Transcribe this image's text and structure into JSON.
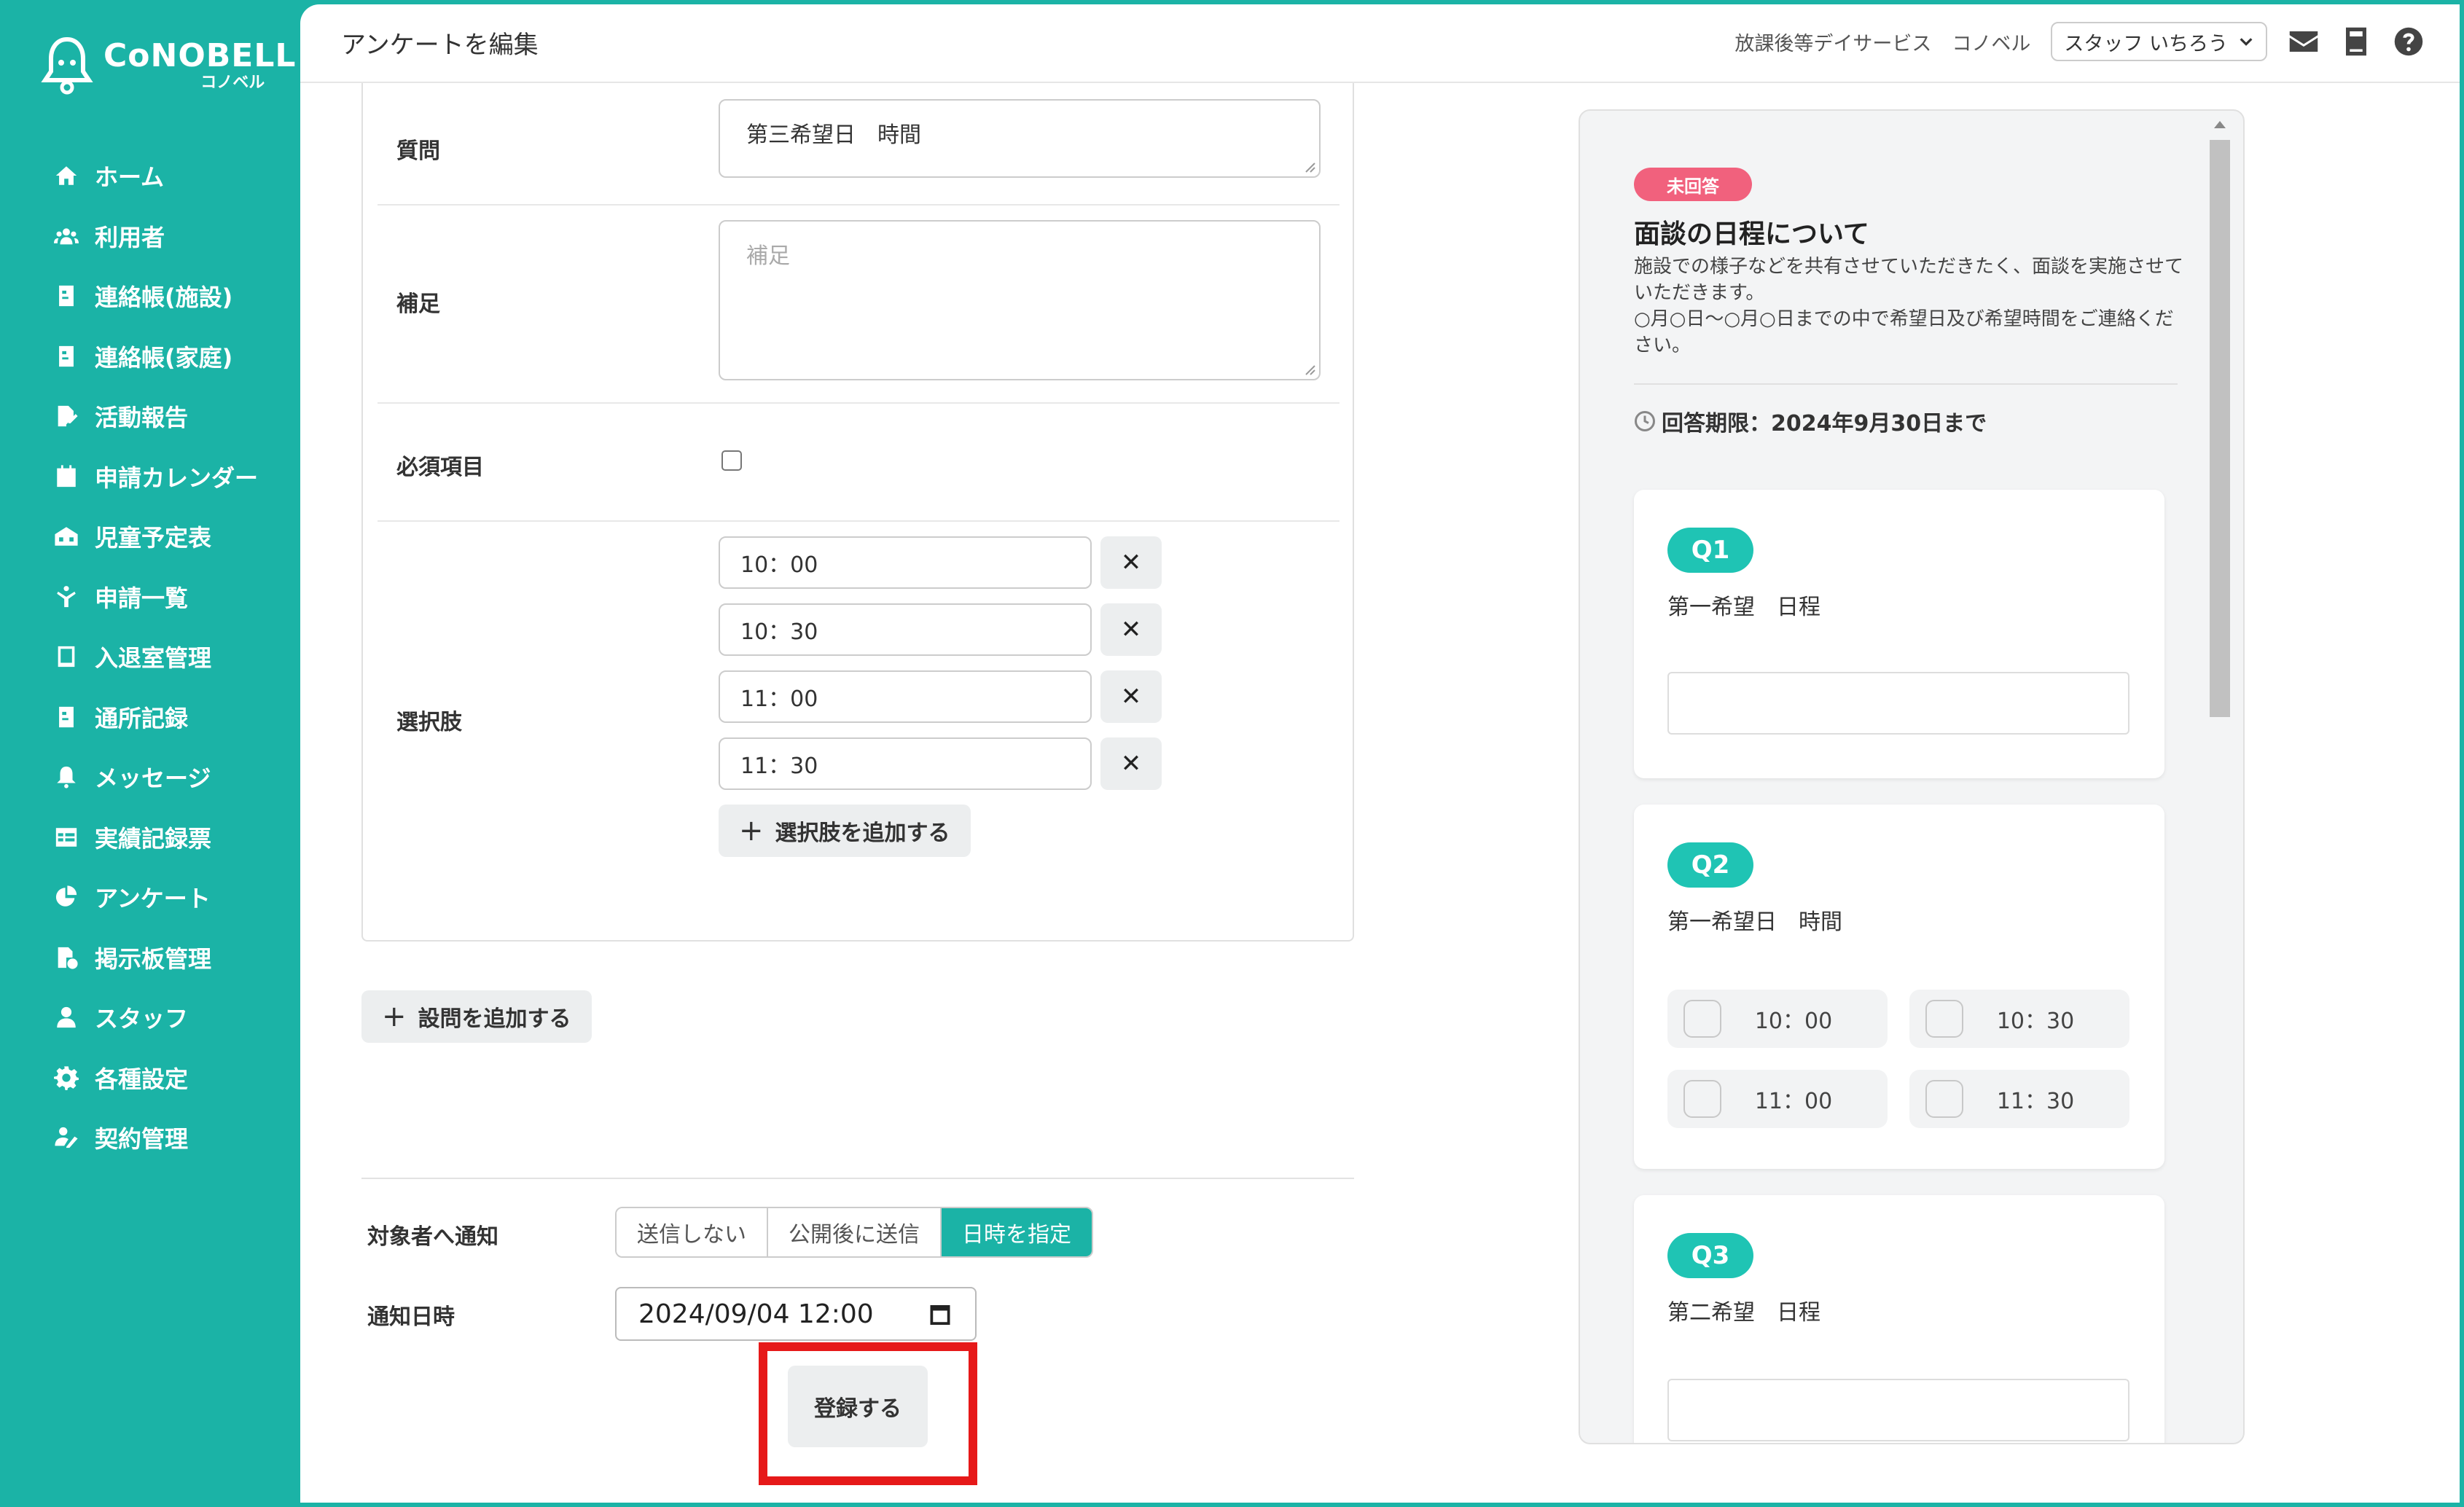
{
  "brand": {
    "name": "CoNOBELL",
    "sub": "コノベル"
  },
  "sidebar": {
    "items": [
      {
        "label": "ホーム",
        "icon": "home-icon"
      },
      {
        "label": "利用者",
        "icon": "users-icon"
      },
      {
        "label": "連絡帳(施設)",
        "icon": "notebook-icon"
      },
      {
        "label": "連絡帳(家庭)",
        "icon": "notebook-icon"
      },
      {
        "label": "活動報告",
        "icon": "report-icon"
      },
      {
        "label": "申請カレンダー",
        "icon": "calendar-icon"
      },
      {
        "label": "児童予定表",
        "icon": "schedule-icon"
      },
      {
        "label": "申請一覧",
        "icon": "request-list-icon"
      },
      {
        "label": "入退室管理",
        "icon": "tablet-icon"
      },
      {
        "label": "通所記録",
        "icon": "record-icon"
      },
      {
        "label": "メッセージ",
        "icon": "bell-icon"
      },
      {
        "label": "実績記録票",
        "icon": "table-icon"
      },
      {
        "label": "アンケート",
        "icon": "pie-chart-icon"
      },
      {
        "label": "掲示板管理",
        "icon": "board-icon"
      },
      {
        "label": "スタッフ",
        "icon": "staff-icon"
      },
      {
        "label": "各種設定",
        "icon": "gear-icon"
      },
      {
        "label": "契約管理",
        "icon": "contract-icon"
      }
    ]
  },
  "header": {
    "title": "アンケートを編集",
    "facility": "放課後等デイサービス",
    "company": "コノベル",
    "staff_selected": "スタッフ いちろう"
  },
  "form": {
    "question_label": "質問",
    "question_value": "第三希望日　時間",
    "note_label": "補足",
    "note_placeholder": "補足",
    "required_label": "必須項目",
    "choices_label": "選択肢",
    "choices": [
      "10：00",
      "10：30",
      "11：00",
      "11：30"
    ],
    "delete_symbol": "✕",
    "add_choice": "選択肢を追加する",
    "add_question": "設問を追加する",
    "plus_symbol": "+"
  },
  "notify": {
    "label": "対象者へ通知",
    "options": [
      "送信しない",
      "公開後に送信",
      "日時を指定"
    ],
    "active_index": 2,
    "datetime_label": "通知日時",
    "datetime_value": "2024/09/04 12:00",
    "submit": "登録する"
  },
  "preview": {
    "status": "未回答",
    "title": "面談の日程について",
    "desc": "施設での様子などを共有させていただきたく、面談を実施させていただきます。\n○月○日～○月○日までの中で希望日及び希望時間をご連絡ください。",
    "deadline": "回答期限：2024年9月30日まで",
    "questions": [
      {
        "no": "Q1",
        "text": "第一希望　日程"
      },
      {
        "no": "Q2",
        "text": "第一希望日　時間",
        "options": [
          "10：00",
          "10：30",
          "11：00",
          "11：30"
        ]
      },
      {
        "no": "Q3",
        "text": "第二希望　日程"
      }
    ]
  },
  "colors": {
    "primary": "#1bb3a6",
    "badge": "#f1617d",
    "highlight": "#e61919"
  }
}
